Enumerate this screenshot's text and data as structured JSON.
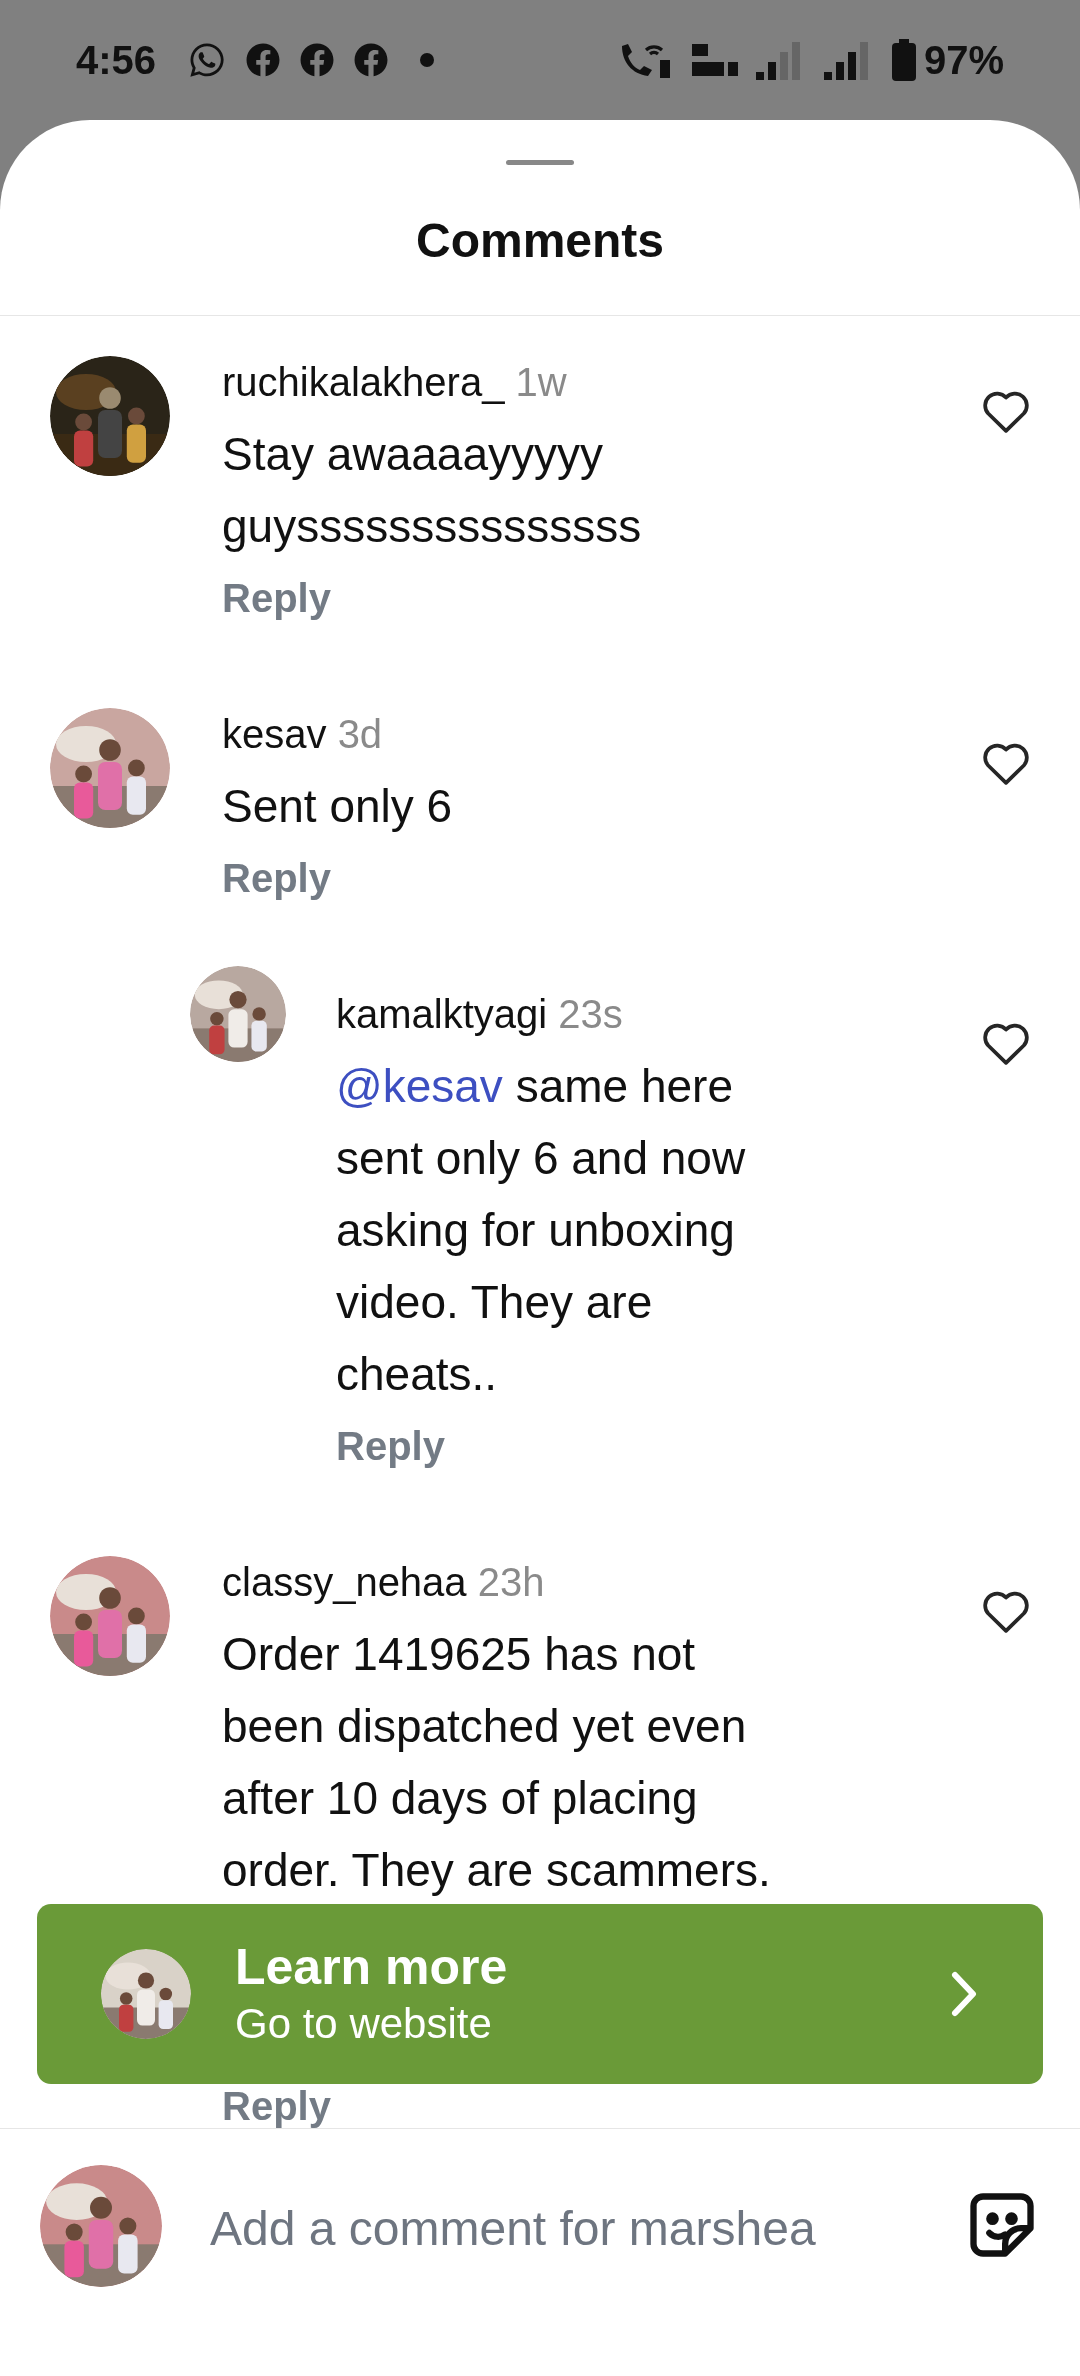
{
  "status_bar": {
    "time": "4:56",
    "battery": "97%"
  },
  "sheet": {
    "title": "Comments"
  },
  "comments": [
    {
      "username": "ruchikalakhera_",
      "age": "1w",
      "text": "Stay awaaaayyyyy guysssssssssssssss",
      "reply": "Reply",
      "nested": false
    },
    {
      "username": "kesav",
      "age": "3d",
      "text": "Sent only 6",
      "reply": "Reply",
      "nested": false
    },
    {
      "username": "kamalktyagi",
      "age": "23s",
      "mention": "@kesav",
      "text": "same here sent only 6 and now asking for unboxing video. They are cheats..",
      "reply": "Reply",
      "nested": true
    },
    {
      "username": "classy_nehaa",
      "age": "23h",
      "text": "Order 1419625 has not been dispatched yet even after 10 days of placing order. They are scammers.",
      "reply": "Reply",
      "nested": false
    }
  ],
  "ad_banner": {
    "title": "Learn more",
    "subtitle": "Go to website"
  },
  "comment_bar": {
    "placeholder": "Add a comment for marshea"
  }
}
